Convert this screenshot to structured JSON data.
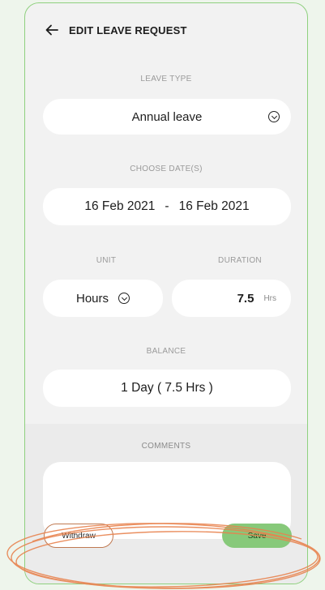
{
  "header": {
    "title": "EDIT LEAVE REQUEST",
    "back_icon": "arrow-left-icon"
  },
  "leave_type": {
    "label": "LEAVE TYPE",
    "value": "Annual leave",
    "icon": "chevron-down-circle-icon"
  },
  "dates": {
    "label": "CHOOSE DATE(S)",
    "start": "16 Feb 2021",
    "separator": "-",
    "end": "16 Feb 2021"
  },
  "unit": {
    "label": "UNIT",
    "value": "Hours",
    "icon": "chevron-down-circle-icon"
  },
  "duration": {
    "label": "DURATION",
    "value": "7.5",
    "suffix": "Hrs"
  },
  "balance": {
    "label": "BALANCE",
    "value": "1 Day ( 7.5 Hrs )"
  },
  "comments": {
    "label": "COMMENTS",
    "value": ""
  },
  "actions": {
    "withdraw_label": "Withdraw",
    "save_label": "Save"
  },
  "colors": {
    "page_bg": "#eef5ec",
    "frame_border": "#8fd07f",
    "save_bg": "#87c97a",
    "annotation": "#e8834f"
  }
}
